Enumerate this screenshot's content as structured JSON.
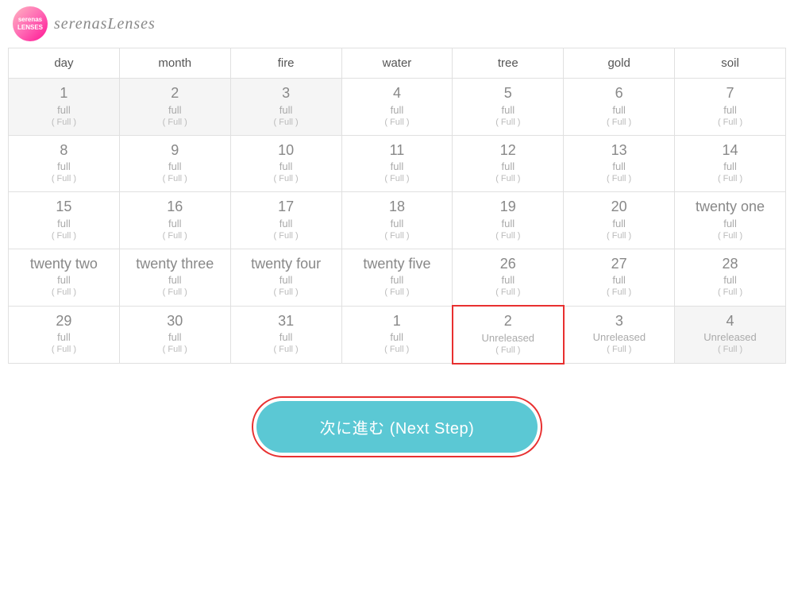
{
  "header": {
    "logo_text": "serenasLenses",
    "logo_inner": "serenas\nLENSES"
  },
  "calendar": {
    "columns": [
      "day",
      "month",
      "fire",
      "water",
      "tree",
      "gold",
      "soil"
    ],
    "rows": [
      [
        {
          "number": "1",
          "label": "full",
          "sub": "( Full )",
          "gray": true
        },
        {
          "number": "2",
          "label": "full",
          "sub": "( Full )",
          "gray": true
        },
        {
          "number": "3",
          "label": "full",
          "sub": "( Full )",
          "gray": true
        },
        {
          "number": "4",
          "label": "full",
          "sub": "( Full )"
        },
        {
          "number": "5",
          "label": "full",
          "sub": "( Full )"
        },
        {
          "number": "6",
          "label": "full",
          "sub": "( Full )"
        },
        {
          "number": "7",
          "label": "full",
          "sub": "( Full )"
        }
      ],
      [
        {
          "number": "8",
          "label": "full",
          "sub": "( Full )"
        },
        {
          "number": "9",
          "label": "full",
          "sub": "( Full )"
        },
        {
          "number": "10",
          "label": "full",
          "sub": "( Full )"
        },
        {
          "number": "11",
          "label": "full",
          "sub": "( Full )"
        },
        {
          "number": "12",
          "label": "full",
          "sub": "( Full )"
        },
        {
          "number": "13",
          "label": "full",
          "sub": "( Full )"
        },
        {
          "number": "14",
          "label": "full",
          "sub": "( Full )"
        }
      ],
      [
        {
          "number": "15",
          "label": "full",
          "sub": "( Full )"
        },
        {
          "number": "16",
          "label": "full",
          "sub": "( Full )"
        },
        {
          "number": "17",
          "label": "full",
          "sub": "( Full )"
        },
        {
          "number": "18",
          "label": "full",
          "sub": "( Full )"
        },
        {
          "number": "19",
          "label": "full",
          "sub": "( Full )"
        },
        {
          "number": "20",
          "label": "full",
          "sub": "( Full )"
        },
        {
          "number": "twenty one",
          "label": "full",
          "sub": "( Full )"
        }
      ],
      [
        {
          "number": "twenty two",
          "label": "full",
          "sub": "( Full )"
        },
        {
          "number": "twenty three",
          "label": "full",
          "sub": "( Full )"
        },
        {
          "number": "twenty four",
          "label": "full",
          "sub": "( Full )"
        },
        {
          "number": "twenty five",
          "label": "full",
          "sub": "( Full )"
        },
        {
          "number": "26",
          "label": "full",
          "sub": "( Full )"
        },
        {
          "number": "27",
          "label": "full",
          "sub": "( Full )"
        },
        {
          "number": "28",
          "label": "full",
          "sub": "( Full )"
        }
      ],
      [
        {
          "number": "29",
          "label": "full",
          "sub": "( Full )"
        },
        {
          "number": "30",
          "label": "full",
          "sub": "( Full )"
        },
        {
          "number": "31",
          "label": "full",
          "sub": "( Full )"
        },
        {
          "number": "1",
          "label": "full",
          "sub": "( Full )"
        },
        {
          "number": "2",
          "label": "Unreleased",
          "sub": "( Full )",
          "highlighted": true
        },
        {
          "number": "3",
          "label": "Unreleased",
          "sub": "( Full )"
        },
        {
          "number": "4",
          "label": "Unreleased",
          "sub": "( Full )",
          "gray": true
        }
      ]
    ]
  },
  "button": {
    "label": "次に進む (Next Step)"
  }
}
